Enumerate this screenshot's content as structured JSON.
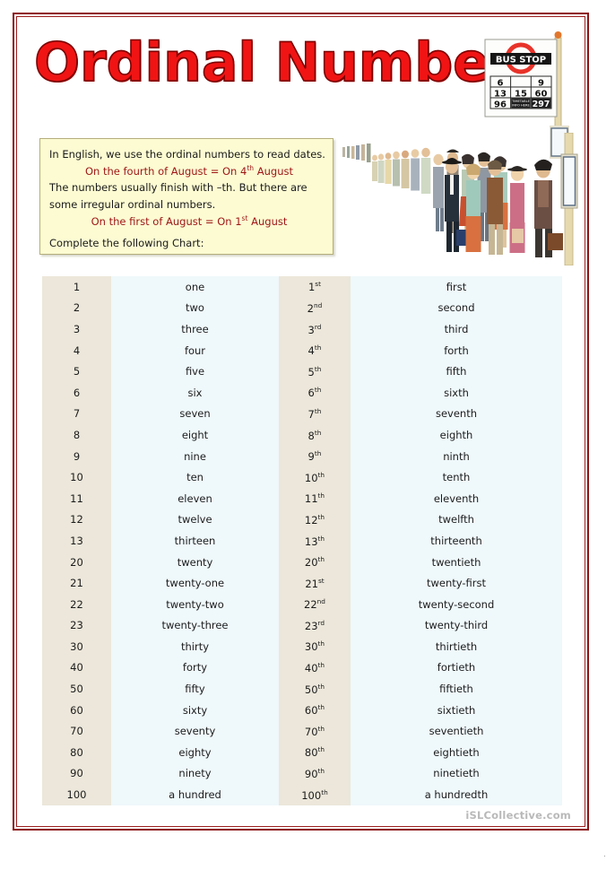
{
  "title": "Ordinal Numbers",
  "bus_stop_sign": {
    "label": "BUS STOP",
    "route_rows": [
      [
        "6",
        "",
        "9"
      ],
      [
        "13",
        "15",
        "60"
      ],
      [
        "96",
        "",
        "297"
      ]
    ]
  },
  "instructions": {
    "line1": "In English, we use the ordinal numbers to read dates.",
    "example1_pre": "On the fourth of August = On 4",
    "example1_sup": "th",
    "example1_post": " August",
    "line2": "The numbers usually finish with –th. But there are",
    "line3": "some irregular ordinal numbers.",
    "example2_pre": "On the first of August = On 1",
    "example2_sup": "st",
    "example2_post": " August",
    "line4": "Complete the following Chart:"
  },
  "chart_rows": [
    {
      "number": "1",
      "word": "one",
      "ordinal": "1",
      "suffix": "st",
      "ordinal_word": "first"
    },
    {
      "number": "2",
      "word": "two",
      "ordinal": "2",
      "suffix": "nd",
      "ordinal_word": "second"
    },
    {
      "number": "3",
      "word": "three",
      "ordinal": "3",
      "suffix": "rd",
      "ordinal_word": "third"
    },
    {
      "number": "4",
      "word": "four",
      "ordinal": "4",
      "suffix": "th",
      "ordinal_word": "forth"
    },
    {
      "number": "5",
      "word": "five",
      "ordinal": "5",
      "suffix": "th",
      "ordinal_word": "fifth"
    },
    {
      "number": "6",
      "word": "six",
      "ordinal": "6",
      "suffix": "th",
      "ordinal_word": "sixth"
    },
    {
      "number": "7",
      "word": "seven",
      "ordinal": "7",
      "suffix": "th",
      "ordinal_word": "seventh"
    },
    {
      "number": "8",
      "word": "eight",
      "ordinal": "8",
      "suffix": "th",
      "ordinal_word": "eighth"
    },
    {
      "number": "9",
      "word": "nine",
      "ordinal": "9",
      "suffix": "th",
      "ordinal_word": "ninth"
    },
    {
      "number": "10",
      "word": "ten",
      "ordinal": "10",
      "suffix": "th",
      "ordinal_word": "tenth"
    },
    {
      "number": "11",
      "word": "eleven",
      "ordinal": "11",
      "suffix": "th",
      "ordinal_word": "eleventh"
    },
    {
      "number": "12",
      "word": "twelve",
      "ordinal": "12",
      "suffix": "th",
      "ordinal_word": "twelfth"
    },
    {
      "number": "13",
      "word": "thirteen",
      "ordinal": "13",
      "suffix": "th",
      "ordinal_word": "thirteenth"
    },
    {
      "number": "20",
      "word": "twenty",
      "ordinal": "20",
      "suffix": "th",
      "ordinal_word": "twentieth"
    },
    {
      "number": "21",
      "word": "twenty-one",
      "ordinal": "21",
      "suffix": "st",
      "ordinal_word": "twenty-first"
    },
    {
      "number": "22",
      "word": "twenty-two",
      "ordinal": "22",
      "suffix": "nd",
      "ordinal_word": "twenty-second"
    },
    {
      "number": "23",
      "word": "twenty-three",
      "ordinal": "23",
      "suffix": "rd",
      "ordinal_word": "twenty-third"
    },
    {
      "number": "30",
      "word": "thirty",
      "ordinal": "30",
      "suffix": "th",
      "ordinal_word": "thirtieth"
    },
    {
      "number": "40",
      "word": "forty",
      "ordinal": "40",
      "suffix": "th",
      "ordinal_word": "fortieth"
    },
    {
      "number": "50",
      "word": "fifty",
      "ordinal": "50",
      "suffix": "th",
      "ordinal_word": "fiftieth"
    },
    {
      "number": "60",
      "word": "sixty",
      "ordinal": "60",
      "suffix": "th",
      "ordinal_word": "sixtieth"
    },
    {
      "number": "70",
      "word": "seventy",
      "ordinal": "70",
      "suffix": "th",
      "ordinal_word": "seventieth"
    },
    {
      "number": "80",
      "word": "eighty",
      "ordinal": "80",
      "suffix": "th",
      "ordinal_word": "eightieth"
    },
    {
      "number": "90",
      "word": "ninety",
      "ordinal": "90",
      "suffix": "th",
      "ordinal_word": "ninetieth"
    },
    {
      "number": "100",
      "word": "a hundred",
      "ordinal": "100",
      "suffix": "th",
      "ordinal_word": "a hundredth"
    }
  ],
  "footer": {
    "watermark": "iSLCollective.com",
    "corner_mark": "."
  },
  "colors": {
    "page_border": "#8e1616",
    "title_red": "#f01414",
    "example_red": "#9e1515",
    "instruction_bg": "#fcfbd2",
    "column_beige": "#ece7da",
    "column_blue": "#eff8fb",
    "watermark_gray": "#b9b9b9"
  }
}
